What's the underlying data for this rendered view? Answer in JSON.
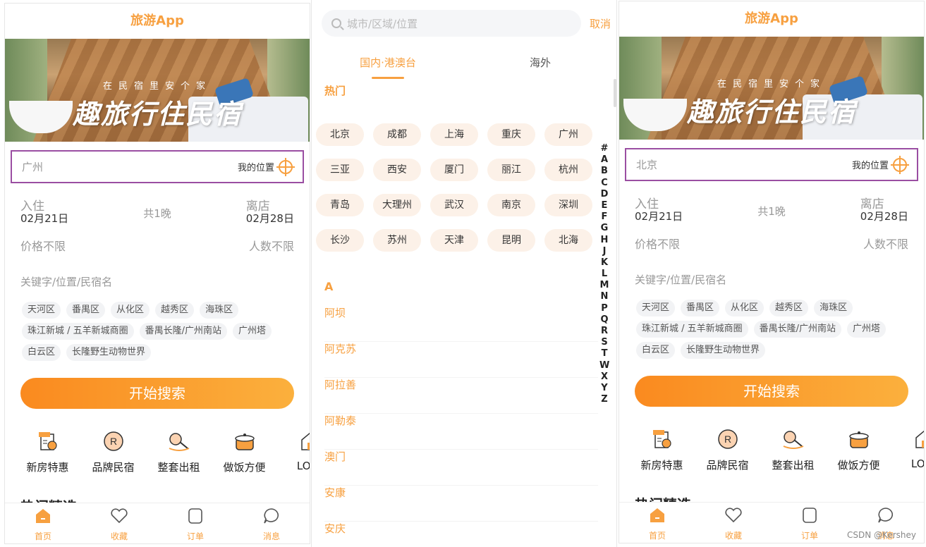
{
  "left": {
    "title": "旅游App",
    "banner": {
      "subtitle": "在民宿里安个家",
      "slogan": "趣旅行住民宿"
    },
    "city": "广州",
    "my_location": "我的位置",
    "checkin_label": "入住",
    "checkin_date": "02月21日",
    "nights": "共1晚",
    "checkout_label": "离店",
    "checkout_date": "02月28日",
    "price": "价格不限",
    "people": "人数不限",
    "keyword_placeholder": "关键字/位置/民宿名",
    "tags": [
      "天河区",
      "番禺区",
      "从化区",
      "越秀区",
      "海珠区",
      "珠江新城 / 五羊新城商圈",
      "番禺长隆/广州南站",
      "广州塔",
      "白云区",
      "长隆野生动物世界"
    ],
    "search_button": "开始搜索",
    "features": [
      "新房特惠",
      "品牌民宿",
      "整套出租",
      "做饭方便",
      "LOFT"
    ],
    "section_cut": "热门精选",
    "tabs": [
      "首页",
      "收藏",
      "订单",
      "消息"
    ]
  },
  "picker": {
    "search_placeholder": "城市/区域/位置",
    "cancel": "取消",
    "tabs": [
      "国内·港澳台",
      "海外"
    ],
    "hot_title": "热门",
    "hot_cities": [
      "北京",
      "成都",
      "上海",
      "重庆",
      "广州",
      "三亚",
      "西安",
      "厦门",
      "丽江",
      "杭州",
      "青岛",
      "大理州",
      "武汉",
      "南京",
      "深圳",
      "长沙",
      "苏州",
      "天津",
      "昆明",
      "北海"
    ],
    "letter": "A",
    "cities_a": [
      "阿坝",
      "阿克苏",
      "阿拉善",
      "阿勒泰",
      "澳门",
      "安康",
      "安庆"
    ],
    "index": [
      "#",
      "A",
      "B",
      "C",
      "D",
      "E",
      "F",
      "G",
      "H",
      "J",
      "K",
      "L",
      "M",
      "N",
      "P",
      "Q",
      "R",
      "S",
      "T",
      "W",
      "X",
      "Y",
      "Z"
    ]
  },
  "right": {
    "title": "旅游App",
    "banner": {
      "subtitle": "在民宿里安个家",
      "slogan": "趣旅行住民宿"
    },
    "city": "北京",
    "my_location": "我的位置",
    "checkin_label": "入住",
    "checkin_date": "02月21日",
    "nights": "共1晚",
    "checkout_label": "离店",
    "checkout_date": "02月28日",
    "price": "价格不限",
    "people": "人数不限",
    "keyword_placeholder": "关键字/位置/民宿名",
    "tags": [
      "天河区",
      "番禺区",
      "从化区",
      "越秀区",
      "海珠区",
      "珠江新城 / 五羊新城商圈",
      "番禺长隆/广州南站",
      "广州塔",
      "白云区",
      "长隆野生动物世界"
    ],
    "search_button": "开始搜索",
    "features": [
      "新房特惠",
      "品牌民宿",
      "整套出租",
      "做饭方便",
      "LOFT"
    ],
    "section_cut": "热门精选",
    "tabs": [
      "首页",
      "收藏",
      "订单",
      "消息"
    ]
  },
  "watermark": "CSDN @Kershey",
  "colors": {
    "accent": "#f7a040",
    "highlight_border": "#9a4ea2",
    "tag_bg": "#f2f3f5",
    "hot_bg": "#fcf1e8"
  },
  "icons": {
    "tabs": [
      "home-icon",
      "heart-icon",
      "order-icon",
      "message-icon"
    ],
    "features": [
      "new-house-icon",
      "brand-icon",
      "key-icon",
      "pot-icon",
      "loft-icon"
    ]
  }
}
